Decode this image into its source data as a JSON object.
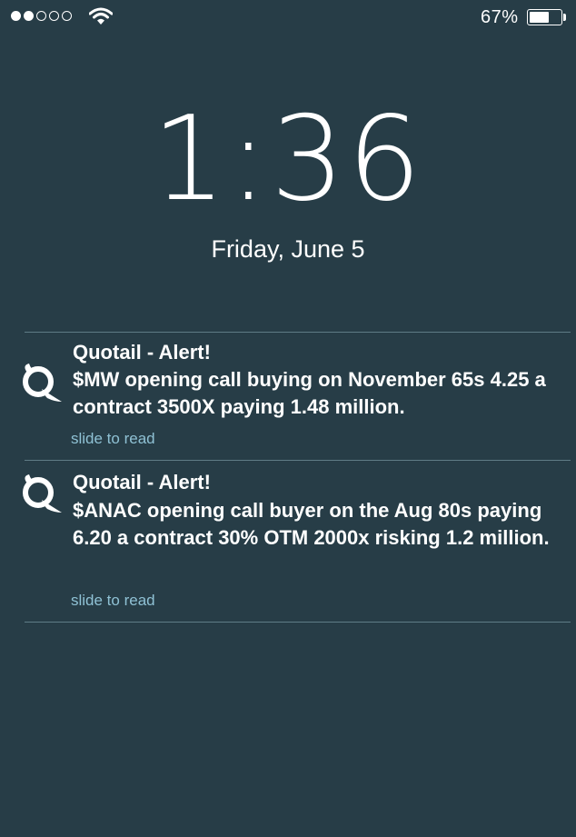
{
  "status_bar": {
    "signal_filled": 2,
    "signal_total": 5,
    "battery_percent_label": "67%",
    "battery_level": 0.67
  },
  "lock_screen": {
    "time": "1:36",
    "date": "Friday, June 5"
  },
  "notifications": [
    {
      "icon": "quotail-q-icon",
      "title": "Quotail - Alert!",
      "body": "$MW opening call buying on November 65s 4.25 a contract 3500X paying 1.48 million.",
      "action": "slide to read"
    },
    {
      "icon": "quotail-q-icon",
      "title": "Quotail - Alert!",
      "body": "$ANAC opening call buyer on the Aug 80s paying 6.20 a contract 30% OTM 2000x risking 1.2 million.",
      "action": "slide to read"
    }
  ],
  "colors": {
    "background": "#273d47",
    "divider": "#5f7c86",
    "action_text": "#8fc1d4"
  }
}
